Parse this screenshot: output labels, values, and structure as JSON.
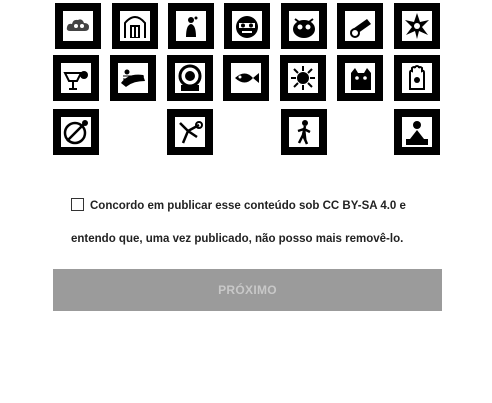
{
  "tiles": [
    {
      "icon": "cloud-icon"
    },
    {
      "icon": "gate-icon"
    },
    {
      "icon": "bottle-figure-icon"
    },
    {
      "icon": "mask-face-icon"
    },
    {
      "icon": "bug-creature-icon"
    },
    {
      "icon": "cannon-icon"
    },
    {
      "icon": "star-burst-icon"
    },
    {
      "icon": "bird-cup-icon"
    },
    {
      "icon": "horse-rider-icon"
    },
    {
      "icon": "diver-icon"
    },
    {
      "icon": "fish-icon"
    },
    {
      "icon": "sun-spider-icon"
    },
    {
      "icon": "cat-icon"
    },
    {
      "icon": "hamsa-hand-icon"
    },
    {
      "icon": "bowling-ball-icon"
    },
    {
      "icon": "robot-figure-icon"
    },
    {
      "icon": "walking-figure-icon"
    },
    {
      "icon": "keyboard-person-icon"
    }
  ],
  "consent": {
    "text": "Concordo em publicar esse conteúdo sob CC BY-SA 4.0 e entendo que, uma vez publicado, não posso mais removê-lo.",
    "checked": false
  },
  "next_button": {
    "label": "PRÓXIMO",
    "disabled": true,
    "color": "#9b9b9b"
  }
}
